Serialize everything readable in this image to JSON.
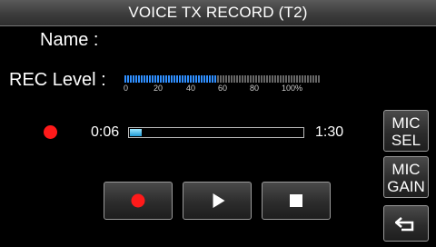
{
  "title": "VOICE TX RECORD  (T2)",
  "name_label": "Name :",
  "rec_level": {
    "label": "REC Level :",
    "scale": [
      "0",
      "20",
      "40",
      "60",
      "80",
      "100%"
    ],
    "level_fraction": 0.47,
    "active_color": "#2f8fff",
    "inactive_color": "#666666"
  },
  "recording": {
    "elapsed": "0:06",
    "total": "1:30",
    "progress_fraction": 0.067
  },
  "buttons": {
    "mic_sel": [
      "MIC",
      "SEL"
    ],
    "mic_gain": [
      "MIC",
      "GAIN"
    ]
  },
  "icons": {
    "rec": "record-icon",
    "play": "play-icon",
    "stop": "stop-icon",
    "back": "return-arrow-icon"
  },
  "colors": {
    "record_red": "#ff1a1a",
    "progress_blue": "#1e9ad6"
  }
}
